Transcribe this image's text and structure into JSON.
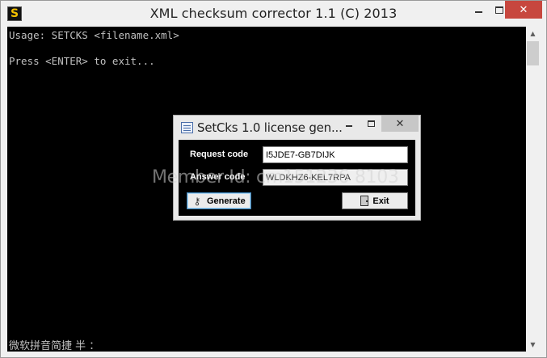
{
  "console": {
    "title": "XML checksum corrector 1.1 (C) 2013",
    "icon": "lightning-s-icon",
    "lines": [
      "Usage: SETCKS <filename.xml>",
      "Press <ENTER> to exit..."
    ],
    "ime_status": "微软拼音简捷 半 ："
  },
  "dialog": {
    "title": "SetCks 1.0 license gen...",
    "request_label": "Request code",
    "request_value": "I5JDE7-GB7DIJK",
    "answer_label": "Answer code",
    "answer_value": "WLDKHZ6-KEL7RPA",
    "generate_label": "Generate",
    "exit_label": "Exit"
  },
  "watermark": "Member Id: cm151236 8103",
  "colors": {
    "console_bg": "#000000",
    "console_text": "#c0c0c0",
    "close_red": "#c7473e"
  }
}
